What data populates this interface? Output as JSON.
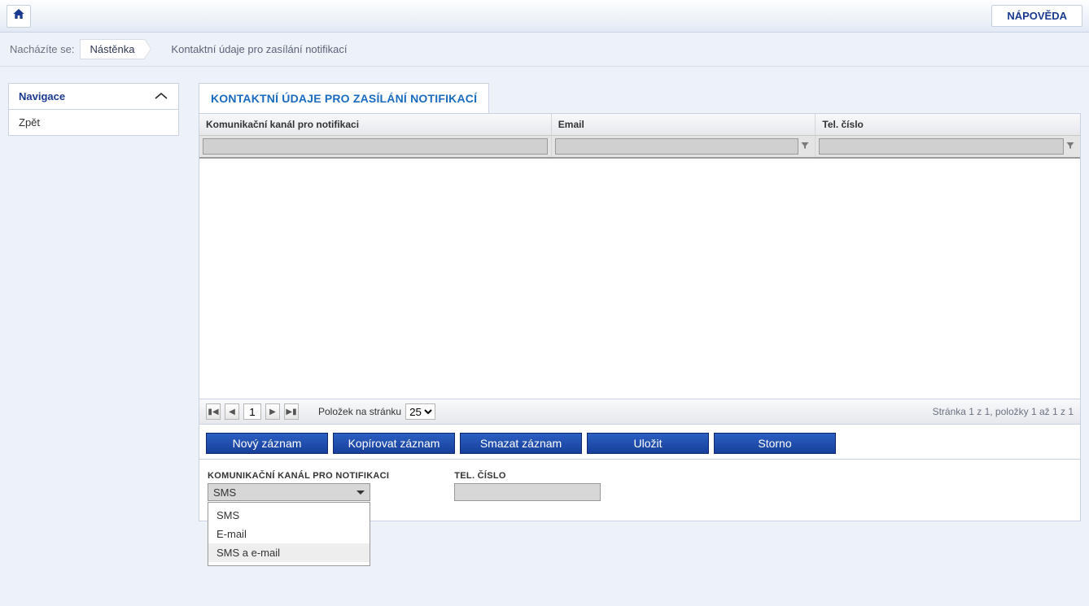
{
  "topbar": {
    "help_label": "NÁPOVĚDA"
  },
  "breadcrumb": {
    "label": "Nacházíte se:",
    "item1": "Nástěnka",
    "item2": "Kontaktní údaje pro zasílání notifikací"
  },
  "sidebar": {
    "title": "Navigace",
    "back_label": "Zpět"
  },
  "panel": {
    "title": "KONTAKTNÍ ÚDAJE PRO ZASÍLÁNÍ NOTIFIKACÍ"
  },
  "grid": {
    "columns": {
      "channel": "Komunikační kanál pro notifikaci",
      "email": "Email",
      "phone": "Tel. číslo"
    },
    "pager": {
      "page_value": "1",
      "items_per_page_label": "Položek na stránku",
      "items_per_page_value": "25",
      "info": "Stránka 1 z 1, položky 1 až 1 z 1"
    }
  },
  "actions": {
    "new": "Nový záznam",
    "copy": "Kopírovat záznam",
    "delete": "Smazat záznam",
    "save": "Uložit",
    "cancel": "Storno"
  },
  "form": {
    "channel_label": "KOMUNIKAČNÍ KANÁL PRO NOTIFIKACI",
    "channel_value": "SMS",
    "channel_options": {
      "opt1": "SMS",
      "opt2": "E-mail",
      "opt3": "SMS a e-mail"
    },
    "phone_label": "TEL. ČÍSLO",
    "phone_value": ""
  }
}
